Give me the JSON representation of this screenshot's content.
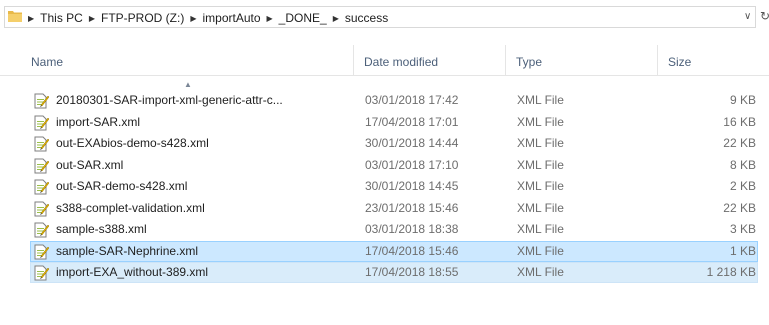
{
  "address_bar": {
    "path": [
      "This PC",
      "FTP-PROD (Z:)",
      "importAuto",
      "_DONE_",
      "success"
    ],
    "dropdown_icon": "chevron-down-icon",
    "refresh_icon": "refresh-icon"
  },
  "columns": {
    "name": "Name",
    "date": "Date modified",
    "type": "Type",
    "size": "Size"
  },
  "files": [
    {
      "name": "20180301-SAR-import-xml-generic-attr-c...",
      "date": "03/01/2018 17:42",
      "type": "XML File",
      "size": "9 KB",
      "selected": false
    },
    {
      "name": "import-SAR.xml",
      "date": "17/04/2018 17:01",
      "type": "XML File",
      "size": "16 KB",
      "selected": false
    },
    {
      "name": "out-EXAbios-demo-s428.xml",
      "date": "30/01/2018 14:44",
      "type": "XML File",
      "size": "22 KB",
      "selected": false
    },
    {
      "name": "out-SAR.xml",
      "date": "03/01/2018 17:10",
      "type": "XML File",
      "size": "8 KB",
      "selected": false
    },
    {
      "name": "out-SAR-demo-s428.xml",
      "date": "30/01/2018 14:45",
      "type": "XML File",
      "size": "2 KB",
      "selected": false
    },
    {
      "name": "s388-complet-validation.xml",
      "date": "23/01/2018 15:46",
      "type": "XML File",
      "size": "22 KB",
      "selected": false
    },
    {
      "name": "sample-s388.xml",
      "date": "03/01/2018 18:38",
      "type": "XML File",
      "size": "3 KB",
      "selected": false
    },
    {
      "name": "sample-SAR-Nephrine.xml",
      "date": "17/04/2018 15:46",
      "type": "XML File",
      "size": "1 KB",
      "selected": true
    },
    {
      "name": "import-EXA_without-389.xml",
      "date": "17/04/2018 18:55",
      "type": "XML File",
      "size": "1 218 KB",
      "selected": true
    }
  ],
  "colors": {
    "selected_bg": "#cce8ff",
    "selected_border": "#99d1ff",
    "header_text": "#4c607a"
  }
}
